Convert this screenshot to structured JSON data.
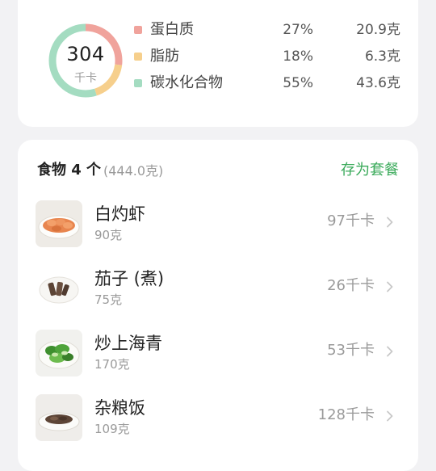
{
  "summary": {
    "total_calories": "304",
    "calories_unit": "千卡",
    "macros": [
      {
        "name": "蛋白质",
        "percent": "27%",
        "amount": "20.9克",
        "color": "#f0a39c",
        "fraction": 0.27
      },
      {
        "name": "脂肪",
        "percent": "18%",
        "amount": "6.3克",
        "color": "#f6cf8c",
        "fraction": 0.18
      },
      {
        "name": "碳水化合物",
        "percent": "55%",
        "amount": "43.6克",
        "color": "#a4dcc1",
        "fraction": 0.55
      }
    ]
  },
  "foods": {
    "title": "食物 4 个",
    "total_weight": "(444.0克)",
    "save_label": "存为套餐",
    "items": [
      {
        "name": "白灼虾",
        "grams": "90克",
        "calories": "97千卡",
        "icon": "shrimp-plate-icon"
      },
      {
        "name": "茄子 (煮)",
        "grams": "75克",
        "calories": "26千卡",
        "icon": "eggplant-plate-icon"
      },
      {
        "name": "炒上海青",
        "grams": "170克",
        "calories": "53千卡",
        "icon": "greens-plate-icon"
      },
      {
        "name": "杂粮饭",
        "grams": "109克",
        "calories": "128千卡",
        "icon": "rice-plate-icon"
      }
    ]
  },
  "colors": {
    "accent_green": "#3aaa5a",
    "muted_text": "#9a9a9a",
    "card_bg": "#ffffff",
    "page_bg": "#f2f2f4"
  }
}
